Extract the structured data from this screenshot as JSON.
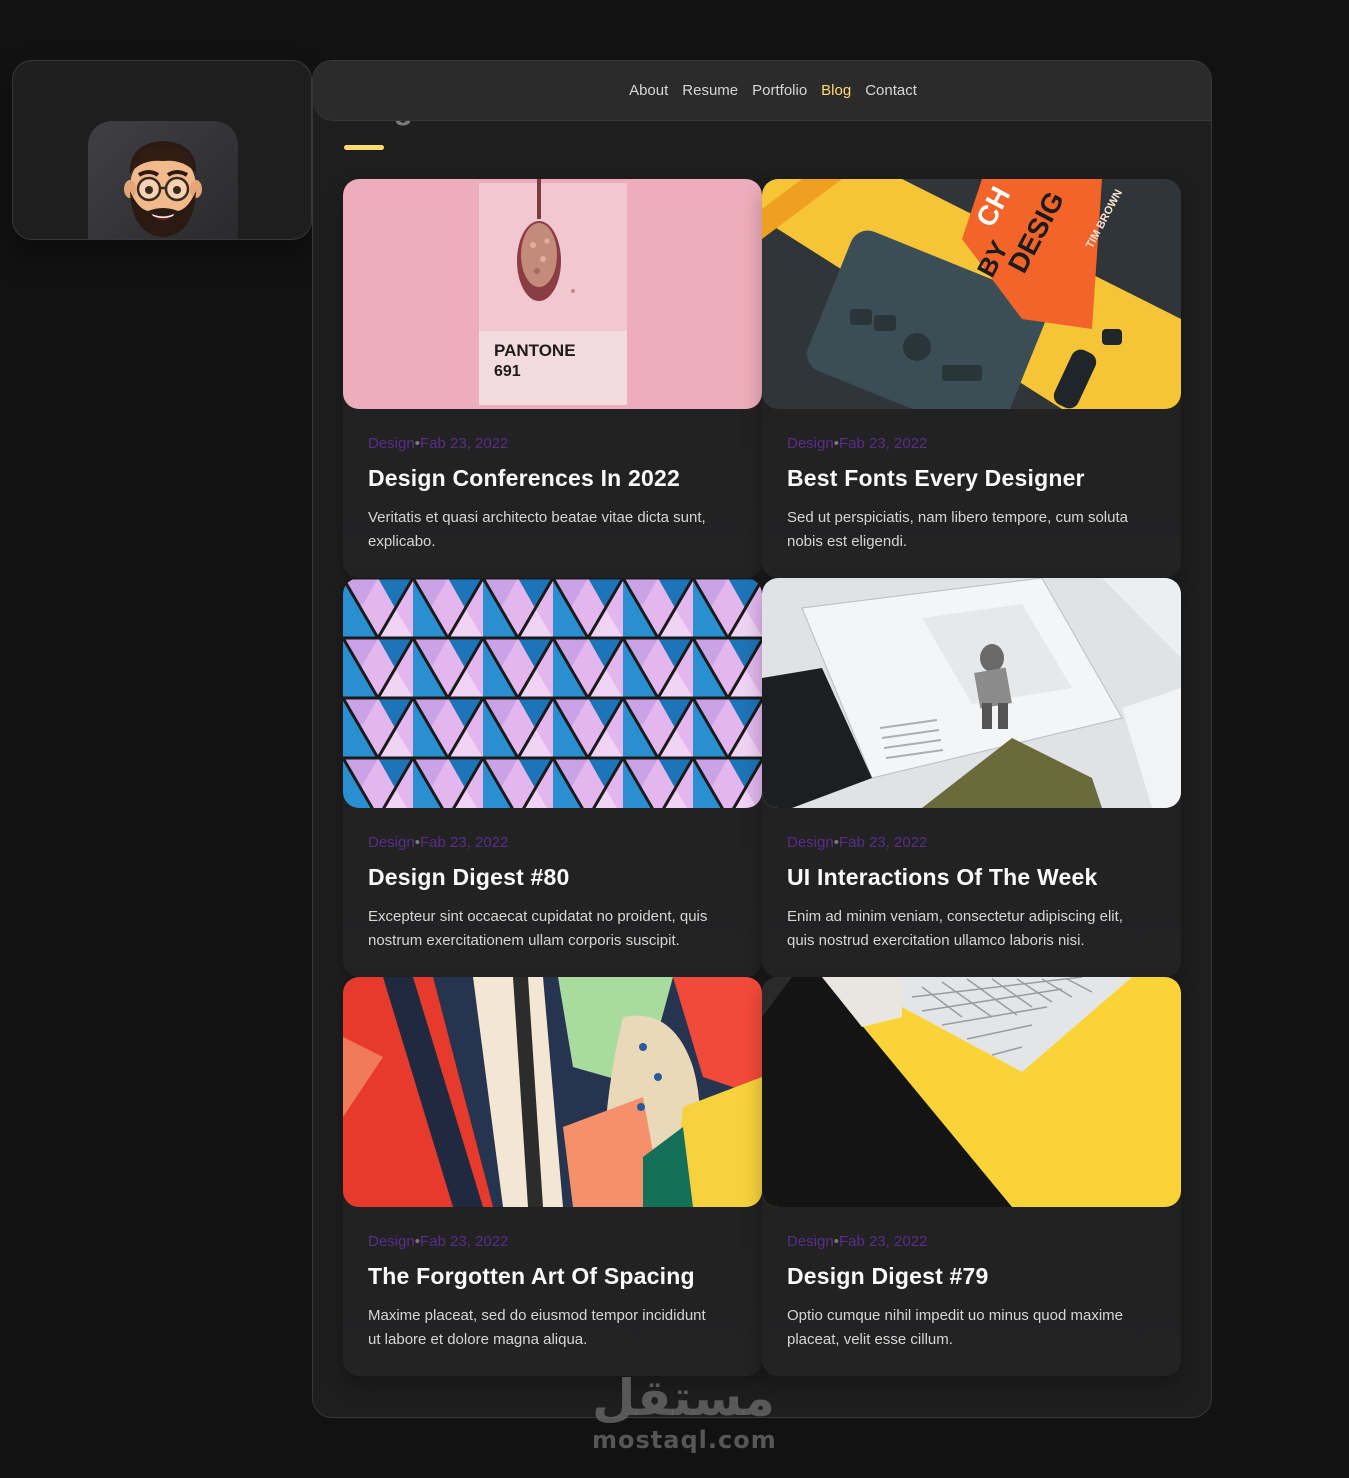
{
  "nav": {
    "items": [
      "About",
      "Resume",
      "Portfolio",
      "Blog",
      "Contact"
    ],
    "active": "Blog"
  },
  "page": {
    "title": "Blog"
  },
  "colors": {
    "accent": "#ffdb70",
    "category": "#5a2d8c",
    "background": "#121212",
    "card": "#1e1e1f"
  },
  "posts": [
    {
      "category": "Design",
      "date": "Fab 23, 2022",
      "title": "Design Conferences In 2022",
      "text": "Veritatis et quasi architecto beatae vitae dicta sunt, explicabo.",
      "image": "pantone-spoon"
    },
    {
      "category": "Design",
      "date": "Fab 23, 2022",
      "title": "Best Fonts Every Designer",
      "text": "Sed ut perspiciatis, nam libero tempore, cum soluta nobis est eligendi.",
      "image": "design-book-tablet"
    },
    {
      "category": "Design",
      "date": "Fab 23, 2022",
      "title": "Design Digest #80",
      "text": "Excepteur sint occaecat cupidatat no proident, quis nostrum exercitationem ullam corporis suscipit.",
      "image": "geometric-pattern"
    },
    {
      "category": "Design",
      "date": "Fab 23, 2022",
      "title": "UI Interactions Of The Week",
      "text": "Enim ad minim veniam, consectetur adipiscing elit, quis nostrud exercitation ullamco laboris nisi.",
      "image": "magazine-layout"
    },
    {
      "category": "Design",
      "date": "Fab 23, 2022",
      "title": "The Forgotten Art Of Spacing",
      "text": "Maxime placeat, sed do eiusmod tempor incididunt ut labore et dolore magna aliqua.",
      "image": "abstract-painting"
    },
    {
      "category": "Design",
      "date": "Fab 23, 2022",
      "title": "Design Digest #79",
      "text": "Optio cumque nihil impedit uo minus quod maxime placeat, velit esse cillum.",
      "image": "keyboard-yellow"
    }
  ],
  "watermark": {
    "arabic": "مستقل",
    "latin": "mostaql.com"
  }
}
